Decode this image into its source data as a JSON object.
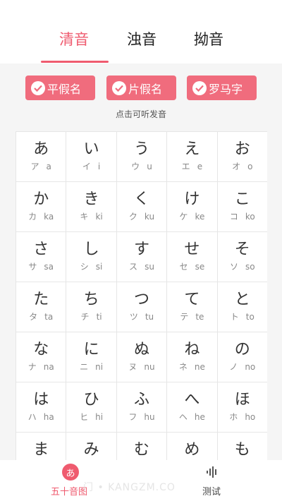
{
  "tabs": [
    {
      "label": "清音",
      "active": true
    },
    {
      "label": "浊音",
      "active": false
    },
    {
      "label": "拗音",
      "active": false
    }
  ],
  "toggles": [
    {
      "label": "平假名",
      "checked": true
    },
    {
      "label": "片假名",
      "checked": true
    },
    {
      "label": "罗马字",
      "checked": true
    }
  ],
  "hint": "点击可听发音",
  "kana": [
    [
      {
        "h": "あ",
        "k": "ア",
        "r": "a"
      },
      {
        "h": "い",
        "k": "イ",
        "r": "i"
      },
      {
        "h": "う",
        "k": "ウ",
        "r": "u"
      },
      {
        "h": "え",
        "k": "エ",
        "r": "e"
      },
      {
        "h": "お",
        "k": "オ",
        "r": "o"
      }
    ],
    [
      {
        "h": "か",
        "k": "カ",
        "r": "ka"
      },
      {
        "h": "き",
        "k": "キ",
        "r": "ki"
      },
      {
        "h": "く",
        "k": "ク",
        "r": "ku"
      },
      {
        "h": "け",
        "k": "ケ",
        "r": "ke"
      },
      {
        "h": "こ",
        "k": "コ",
        "r": "ko"
      }
    ],
    [
      {
        "h": "さ",
        "k": "サ",
        "r": "sa"
      },
      {
        "h": "し",
        "k": "シ",
        "r": "si"
      },
      {
        "h": "す",
        "k": "ス",
        "r": "su"
      },
      {
        "h": "せ",
        "k": "セ",
        "r": "se"
      },
      {
        "h": "そ",
        "k": "ソ",
        "r": "so"
      }
    ],
    [
      {
        "h": "た",
        "k": "タ",
        "r": "ta"
      },
      {
        "h": "ち",
        "k": "チ",
        "r": "ti"
      },
      {
        "h": "つ",
        "k": "ツ",
        "r": "tu"
      },
      {
        "h": "て",
        "k": "テ",
        "r": "te"
      },
      {
        "h": "と",
        "k": "ト",
        "r": "to"
      }
    ],
    [
      {
        "h": "な",
        "k": "ナ",
        "r": "na"
      },
      {
        "h": "に",
        "k": "ニ",
        "r": "ni"
      },
      {
        "h": "ぬ",
        "k": "ヌ",
        "r": "nu"
      },
      {
        "h": "ね",
        "k": "ネ",
        "r": "ne"
      },
      {
        "h": "の",
        "k": "ノ",
        "r": "no"
      }
    ],
    [
      {
        "h": "は",
        "k": "ハ",
        "r": "ha"
      },
      {
        "h": "ひ",
        "k": "ヒ",
        "r": "hi"
      },
      {
        "h": "ふ",
        "k": "フ",
        "r": "hu"
      },
      {
        "h": "へ",
        "k": "ヘ",
        "r": "he"
      },
      {
        "h": "ほ",
        "k": "ホ",
        "r": "ho"
      }
    ],
    [
      {
        "h": "ま",
        "k": "",
        "r": ""
      },
      {
        "h": "み",
        "k": "",
        "r": ""
      },
      {
        "h": "む",
        "k": "",
        "r": ""
      },
      {
        "h": "め",
        "k": "",
        "r": ""
      },
      {
        "h": "も",
        "k": "",
        "r": ""
      }
    ]
  ],
  "bottom_nav": [
    {
      "icon_glyph": "あ",
      "label": "五十音图",
      "active": true,
      "icon": "hiragana-badge-icon"
    },
    {
      "label": "测试",
      "active": false,
      "icon": "sound-wave-icon"
    }
  ],
  "watermark": "门 • KANGZM.CO",
  "colors": {
    "accent": "#ef5b6f",
    "chip": "#f06c7d"
  }
}
